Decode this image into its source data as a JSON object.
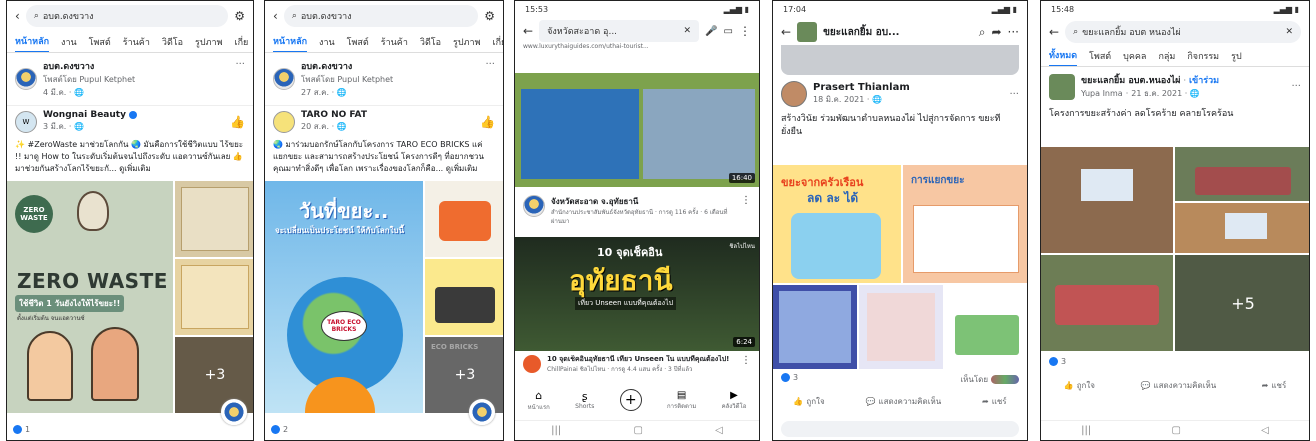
{
  "phone1": {
    "search_text": "อบต.ดงขวาง",
    "tabs": [
      "หน้าหลัก",
      "งาน",
      "โพสต์",
      "ร้านค้า",
      "วิดีโอ",
      "รูปภาพ",
      "เกี่ย"
    ],
    "page_name": "อบต.ดงขวาง",
    "page_sub": "โพสต์โดย Pupul Ketphet",
    "page_time": "4 มี.ค. · 🌐",
    "post_author": "Wongnai Beauty",
    "post_time": "3 มี.ค. · 🌐",
    "post_text": "✨ #ZeroWaste มาช่วยโลกกัน 🌏 มันคือการใช้ชีวิตแบบ ไร้ขยะ !! มาดู How to ในระดับเริ่มต้นจนไปถึงระดับ แอดวานซ์กันเลย 👍 มาช่วยกันสร้างโลกไร้ขยะกั... ดูเพิ่มเติม",
    "image_title": "ZERO WASTE",
    "image_sub": "ใช้ชีวิต 1 วันยังไงให้ไร้ขยะ!!",
    "image_tag": "ZERO WASTE",
    "image_small": "ตั้งแต่เริ่มต้น จนแอดวานซ์",
    "more_count": "+3",
    "reaction_count": "1"
  },
  "phone2": {
    "search_text": "อบต.ดงขวาง",
    "tabs": [
      "หน้าหลัก",
      "งาน",
      "โพสต์",
      "ร้านค้า",
      "วิดีโอ",
      "รูปภาพ",
      "เกี่ย"
    ],
    "page_name": "อบต.ดงขวาง",
    "page_sub": "โพสต์โดย Pupul Ketphet",
    "page_time": "27 ส.ค. · 🌐",
    "post_author": "TARO NO FAT",
    "post_time": "20 ส.ค. · 🌐",
    "post_text": "🌏 มาร่วมบอกรักษ์โลกกับโครงการ TARO ECO BRICKS แค่แยกขยะ และสามารถสร้างประโยชน์ โครงการดีๆ ที่อยากชวนคุณมาทำสิ่งดีๆ เพื่อโลก เพราะเรื่องของโลกก็คือ... ดูเพิ่มเติม",
    "image_title": "วันที่ขยะ..",
    "image_sub": "จะเปลี่ยนเป็นประโยชน์ ให้กับโลกใบนี้",
    "badge": "TARO ECO BRICKS",
    "side_label": "ECO BRICKS",
    "more_count": "+3",
    "reaction_count": "2"
  },
  "phone3": {
    "time": "15:53",
    "url_title": "จังหวัดสะอาด อุ...",
    "url_host": "www.luxurythaiguides.com/uthai-tourist...",
    "video1_duration": "16:40",
    "channel_name": "จังหวัดสะอาด จ.อุทัยธานี",
    "channel_sub": "สำนักงานประชาสัมพันธ์จังหวัดอุทัยธานี · การดู 116 ครั้ง · 6 เดือนที่ผ่านมา",
    "thumb2_brand": "ชิลไปไหน",
    "thumb2_top": "10 จุดเช็คอิน",
    "thumb2_big": "อุทัยธานี",
    "thumb2_small": "เที่ยว Unseen แบบที่คุณต้องไป",
    "video2_duration": "6:24",
    "video2_title": "10 จุดเช็คอินอุทัยธานี เที่ยว Unseen ใน แบบที่คุณต้องไป!",
    "video2_sub": "ChillPainai ชิลไปไหน · การดู 4.4 แสน ครั้ง · 3 ปีที่แล้ว",
    "nav": [
      "หน้าแรก",
      "Shorts",
      "",
      "การติดตาม",
      "คลังวิดีโอ"
    ]
  },
  "phone4": {
    "time": "17:04",
    "header_title": "ขยะแลกยิ้ม อบ...",
    "author": "Prasert Thianlam",
    "post_time": "18 มิ.ค. 2021 · 🌐",
    "post_text": "สร้างวินัย ร่วมพัฒนาตำบลหนองไผ่ ไปสู่การจัดการ ขยะที่ยั่งยืน",
    "poster_title": "ขยะจากครัวเรือน",
    "poster_sub": "ลด ละ ได้",
    "poster_side": "การแยกขยะ",
    "reaction_count": "3",
    "reacted_by": "เห็นโดย",
    "like": "ถูกใจ",
    "comment": "แสดงความคิดเห็น",
    "share": "แชร์"
  },
  "phone5": {
    "time": "15:48",
    "search_text": "ขยะแลกยิ้ม อบต หนองไผ่",
    "tabs": [
      "ทั้งหมด",
      "โพสต์",
      "บุคคล",
      "กลุ่ม",
      "กิจกรรม",
      "รูป"
    ],
    "group_name": "ขยะแลกยิ้ม อบต.หนองไผ่",
    "join": "เข้าร่วม",
    "author": "Yupa Inma",
    "post_time": "21 ธ.ค. 2021 · 🌐",
    "post_text": "โครงการขยะสร้างค่า ลดโรคร้าย คลายโรคร้อน",
    "more_count": "+5",
    "reaction_count": "3",
    "like": "ถูกใจ",
    "comment": "แสดงความคิดเห็น",
    "share": "แชร์"
  }
}
